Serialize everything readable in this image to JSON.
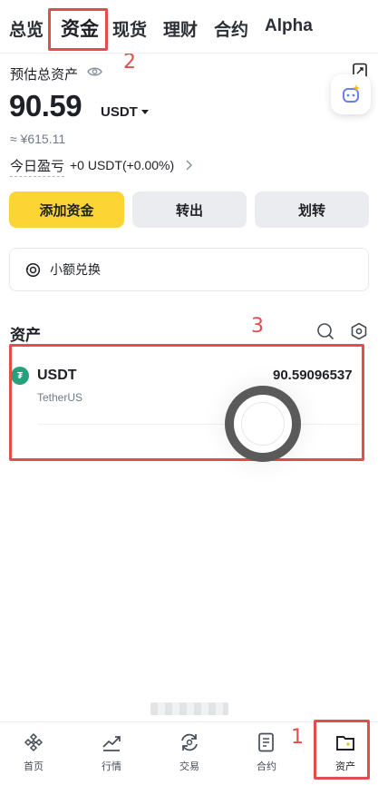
{
  "top_tabs": [
    {
      "label": "总览"
    },
    {
      "label": "资金"
    },
    {
      "label": "现货"
    },
    {
      "label": "理财"
    },
    {
      "label": "合约"
    },
    {
      "label": "Alpha"
    }
  ],
  "annotations": {
    "tab_box": "2",
    "assets_box": "3",
    "nav_box": "1"
  },
  "balance": {
    "label": "预估总资产",
    "amount": "90.59",
    "unit": "USDT",
    "fiat": "≈ ¥615.11",
    "pnl_label": "今日盈亏",
    "pnl_value": "+0 USDT(+0.00%)"
  },
  "actions": {
    "add_funds": "添加资金",
    "withdraw": "转出",
    "transfer": "划转"
  },
  "small_convert": {
    "label": "小额兑换"
  },
  "assets": {
    "title": "资产",
    "items": [
      {
        "symbol": "USDT",
        "name": "TetherUS",
        "amount": "90.59096537"
      }
    ]
  },
  "bottom_nav": [
    {
      "label": "首页"
    },
    {
      "label": "行情"
    },
    {
      "label": "交易"
    },
    {
      "label": "合约"
    },
    {
      "label": "资产"
    }
  ],
  "colors": {
    "accent": "#fcd535",
    "annotation": "#e24e4e",
    "usdt": "#26a17b"
  }
}
